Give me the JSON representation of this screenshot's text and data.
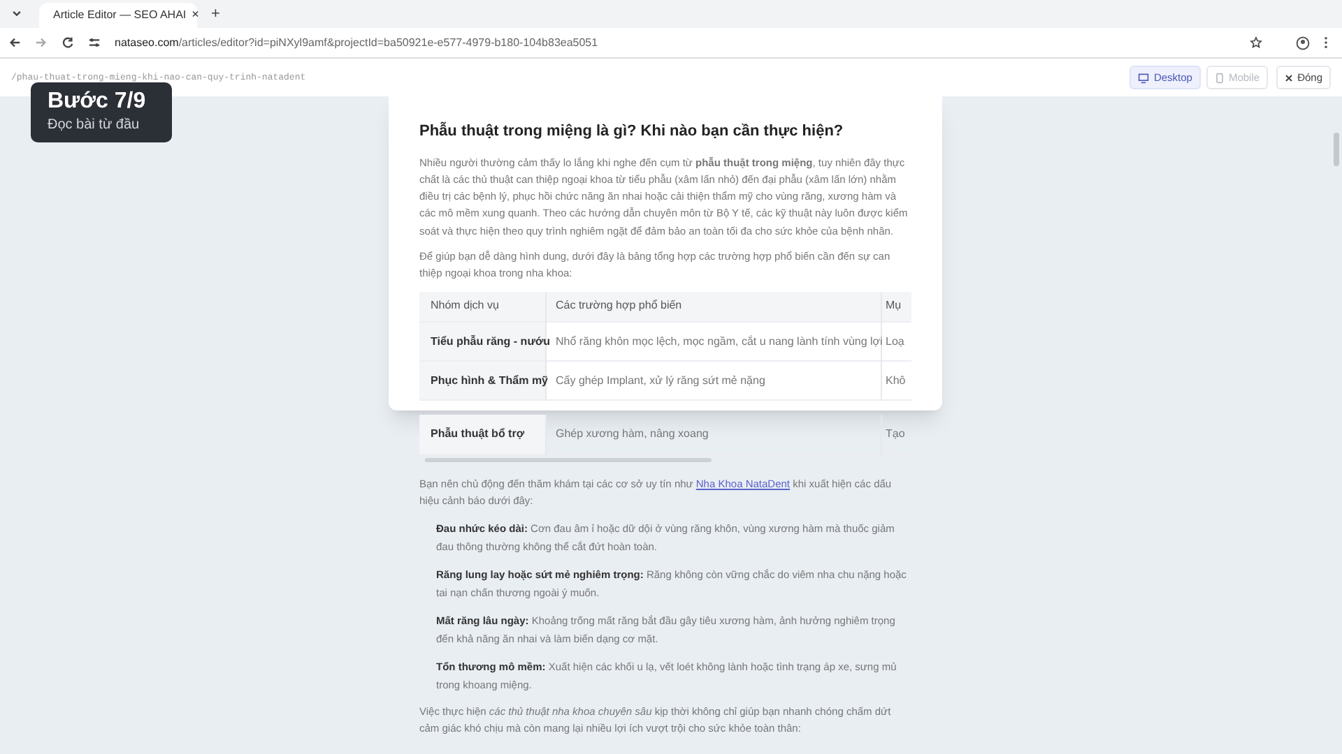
{
  "browser": {
    "tab": {
      "title": "Article Editor — SEO AHAI",
      "close": "×"
    },
    "new_tab": "+",
    "url_host": "nataseo.com",
    "url_path": "/articles/editor?id=piNXyl9amf&projectId=ba50921e-e577-4979-b180-104b83ea5051"
  },
  "toolbar": {
    "slug": "/phau-thuat-trong-mieng-khi-nao-can-quy-trinh-natadent",
    "views": [
      {
        "label": "Desktop",
        "kind": "desktop",
        "selected": true
      },
      {
        "label": "Mobile",
        "kind": "mobile",
        "selected": false
      }
    ],
    "close": "Đóng"
  },
  "step_badge": {
    "title": "Bước 7/9",
    "subtitle": "Đọc bài từ đầu"
  },
  "article": {
    "heading": "Phẫu thuật trong miệng là gì? Khi nào bạn cần thực hiện?",
    "paragraphs": [
      "Nhiều người thường cảm thấy lo lắng khi nghe đến cụm từ **phẫu thuật trong miệng**, tuy nhiên đây thực chất là các thủ thuật can thiệp ngoại khoa từ tiểu phẫu (xâm lấn nhỏ) đến đại phẫu (xâm lấn lớn) nhằm điều trị các bệnh lý, phục hồi chức năng ăn nhai hoặc cải thiện thẩm mỹ cho vùng răng, xương hàm và các mô mềm xung quanh. Theo các hướng dẫn chuyên môn từ Bộ Y tế, các kỹ thuật này luôn được kiểm soát và thực hiện theo quy trình nghiêm ngặt để đảm bảo an toàn tối đa cho sức khỏe của bệnh nhân.",
      "Để giúp bạn dễ dàng hình dung, dưới đây là bảng tổng hợp các trường hợp phổ biến cần đến sự can thiệp ngoại khoa trong nha khoa:"
    ],
    "table": {
      "columns": [
        "Nhóm dịch vụ",
        "Các trường hợp phổ biến",
        "Mụ"
      ],
      "rows": [
        [
          "Tiểu phẫu răng - nướu",
          "Nhổ răng khôn mọc lệch, mọc ngầm, cắt u nang lành tính vùng lợi",
          "Loạ"
        ],
        [
          "Phục hình & Thẩm mỹ",
          "Cấy ghép Implant, xử lý răng sứt mẻ nặng",
          "Khô"
        ],
        [
          "Phẫu thuật bổ trợ",
          "Ghép xương hàm, nâng xoang",
          "Tạo"
        ]
      ]
    },
    "intro": {
      "before": "Bạn nên chủ động đến thăm khám tại các cơ sở uy tín như ",
      "link": "Nha Khoa NataDent",
      "after": " khi xuất hiện các dấu hiệu cảnh báo dưới đây:"
    },
    "signs": [
      "**Đau nhức kéo dài:** Cơn đau âm ỉ hoặc dữ dội ở vùng răng khôn, vùng xương hàm mà thuốc giảm đau thông thường không thể cắt đứt hoàn toàn.",
      "**Răng lung lay hoặc sứt mẻ nghiêm trọng:** Răng không còn vững chắc do viêm nha chu nặng hoặc tai nạn chấn thương ngoài ý muốn.",
      "**Mất răng lâu ngày:** Khoảng trống mất răng bắt đầu gây tiêu xương hàm, ảnh hưởng nghiêm trọng đến khả năng ăn nhai và làm biến dạng cơ mặt.",
      "**Tổn thương mô mềm:** Xuất hiện các khối u lạ, vết loét không lành hoặc tình trạng áp xe, sưng mủ trong khoang miệng."
    ],
    "closing": "Việc thực hiện *các thủ thuật nha khoa chuyên sâu* kịp thời không chỉ giúp bạn nhanh chóng chấm dứt cảm giác khó chịu mà còn mang lại nhiều lợi ích vượt trội cho sức khỏe toàn thân:"
  }
}
